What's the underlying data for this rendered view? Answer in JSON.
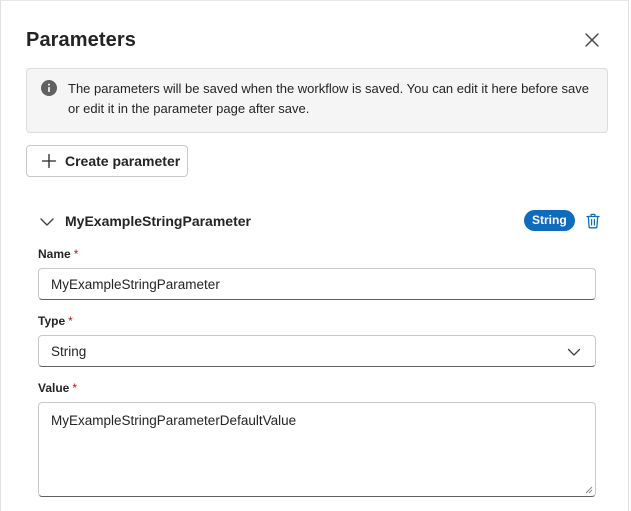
{
  "panel": {
    "title": "Parameters",
    "close_icon": "close-icon"
  },
  "banner": {
    "icon": "info-icon",
    "message": "The parameters will be saved when the workflow is saved. You can edit it here before save or edit it in the parameter page after save."
  },
  "toolbar": {
    "create_label": "Create parameter",
    "create_icon": "plus-icon"
  },
  "parameter": {
    "header_name": "MyExampleStringParameter",
    "type_badge": "String",
    "expand_icon": "chevron-down-icon",
    "delete_icon": "trash-icon",
    "accent_color": "#0f6cbd",
    "fields": {
      "name_label": "Name",
      "name_value": "MyExampleStringParameter",
      "type_label": "Type",
      "type_value": "String",
      "value_label": "Value",
      "value_value": "MyExampleStringParameterDefaultValue",
      "required_marker": "*"
    }
  }
}
